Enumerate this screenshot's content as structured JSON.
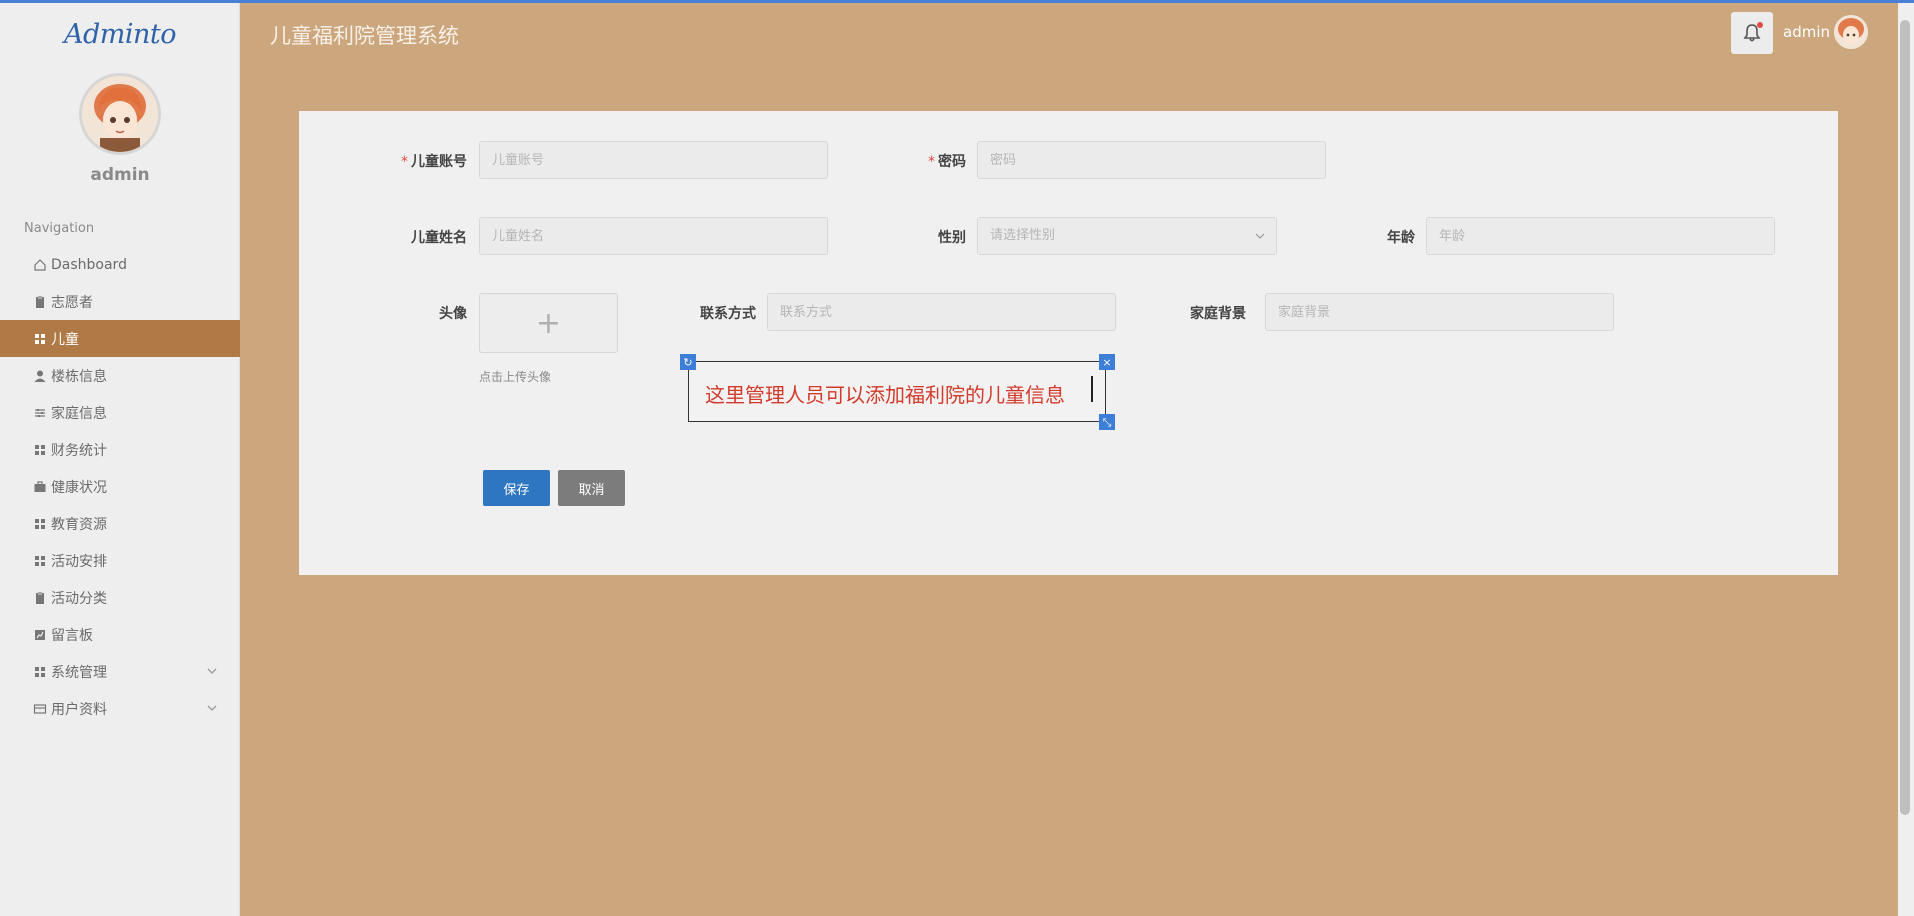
{
  "app": {
    "logo": "Adminto",
    "title": "儿童福利院管理系统",
    "header_user": "admin"
  },
  "sidebar": {
    "username": "admin",
    "nav_heading": "Navigation",
    "items": [
      {
        "label": "Dashboard",
        "icon": "home-icon",
        "active": false
      },
      {
        "label": "志愿者",
        "icon": "clipboard-icon",
        "active": false
      },
      {
        "label": "儿童",
        "icon": "grid-icon",
        "active": true
      },
      {
        "label": "楼栋信息",
        "icon": "user-icon",
        "active": false
      },
      {
        "label": "家庭信息",
        "icon": "sliders-icon",
        "active": false
      },
      {
        "label": "财务统计",
        "icon": "grid-icon",
        "active": false
      },
      {
        "label": "健康状况",
        "icon": "briefcase-icon",
        "active": false
      },
      {
        "label": "教育资源",
        "icon": "grid-icon",
        "active": false
      },
      {
        "label": "活动安排",
        "icon": "grid-icon",
        "active": false
      },
      {
        "label": "活动分类",
        "icon": "clipboard-icon",
        "active": false
      },
      {
        "label": "留言板",
        "icon": "chart-icon",
        "active": false
      },
      {
        "label": "系统管理",
        "icon": "grid-icon",
        "active": false,
        "expandable": true
      },
      {
        "label": "用户资料",
        "icon": "card-icon",
        "active": false,
        "expandable": true
      }
    ]
  },
  "form": {
    "account": {
      "label": "儿童账号",
      "placeholder": "儿童账号",
      "required": true
    },
    "password": {
      "label": "密码",
      "placeholder": "密码",
      "required": true
    },
    "name": {
      "label": "儿童姓名",
      "placeholder": "儿童姓名"
    },
    "gender": {
      "label": "性别",
      "placeholder": "请选择性别"
    },
    "age": {
      "label": "年龄",
      "placeholder": "年龄"
    },
    "avatar": {
      "label": "头像",
      "plus": "+",
      "hint": "点击上传头像"
    },
    "contact": {
      "label": "联系方式",
      "placeholder": "联系方式"
    },
    "family": {
      "label": "家庭背景",
      "placeholder": "家庭背景"
    },
    "save": "保存",
    "cancel": "取消"
  },
  "annotation": {
    "text": "这里管理人员可以添加福利院的儿童信息",
    "handle_rotate": "↻",
    "handle_close": "×",
    "handle_resize": "⤡"
  },
  "colors": {
    "accent": "#b07a47",
    "background": "#cca67c",
    "save_button": "#2f76c1",
    "cancel_button": "#7c7c7c",
    "annotation_text": "#d23b2b"
  }
}
